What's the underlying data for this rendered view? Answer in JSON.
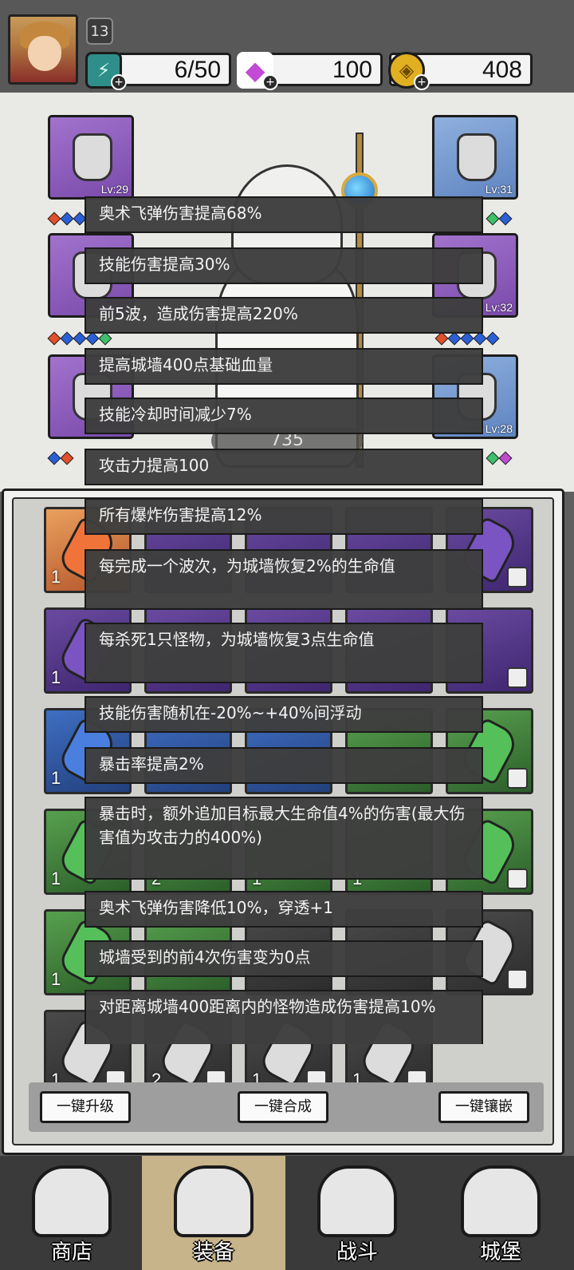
{
  "player": {
    "level": "13",
    "energy": "6/50",
    "gems": "100",
    "coins": "408"
  },
  "equipment": {
    "left": [
      {
        "level": "Lv:29"
      },
      {
        "level": ""
      },
      {
        "level": ""
      }
    ],
    "right": [
      {
        "level": "Lv:31"
      },
      {
        "level": "Lv:32"
      },
      {
        "level": "Lv:28"
      }
    ],
    "power": "735"
  },
  "inventory": {
    "rows": [
      {
        "cells": [
          {
            "count": "1"
          },
          {
            "count": ""
          },
          {
            "count": ""
          },
          {
            "count": ""
          },
          {
            "count": ""
          }
        ]
      },
      {
        "cells": [
          {
            "count": "1"
          },
          {
            "count": ""
          },
          {
            "count": ""
          },
          {
            "count": ""
          },
          {
            "count": ""
          }
        ]
      },
      {
        "cells": [
          {
            "count": "1"
          },
          {
            "count": ""
          },
          {
            "count": ""
          },
          {
            "count": ""
          },
          {
            "count": ""
          }
        ]
      },
      {
        "cells": [
          {
            "count": "1"
          },
          {
            "count": "2"
          },
          {
            "count": "1"
          },
          {
            "count": "1"
          },
          {
            "count": ""
          }
        ]
      },
      {
        "cells": [
          {
            "count": "1"
          },
          {
            "count": ""
          },
          {
            "count": ""
          },
          {
            "count": ""
          },
          {
            "count": ""
          }
        ]
      },
      {
        "cells": [
          {
            "count": "1"
          },
          {
            "count": "2"
          },
          {
            "count": "1"
          },
          {
            "count": "1"
          }
        ]
      }
    ],
    "buttons": {
      "upgrade": "一键升级",
      "merge": "一键合成",
      "inlay": "一键镶嵌"
    }
  },
  "tooltip": {
    "lines": [
      "奥术飞弹伤害提高68%",
      "技能伤害提高30%",
      "前5波，造成伤害提高220%",
      "提高城墙400点基础血量",
      "技能冷却时间减少7%",
      "攻击力提高100",
      "所有爆炸伤害提高12%",
      "每完成一个波次，为城墙恢复2%的生命值",
      "每杀死1只怪物，为城墙恢复3点生命值",
      "技能伤害随机在-20%~+40%间浮动",
      "暴击率提高2%",
      "暴击时，额外追加目标最大生命值4%的伤害(最大伤害值为攻击力的400%)",
      "奥术飞弹伤害降低10%，穿透+1",
      "城墙受到的前4次伤害变为0点",
      "对距离城墙400距离内的怪物造成伤害提高10%"
    ]
  },
  "nav": {
    "shop": "商店",
    "equipment": "装备",
    "battle": "战斗",
    "castle": "城堡"
  }
}
